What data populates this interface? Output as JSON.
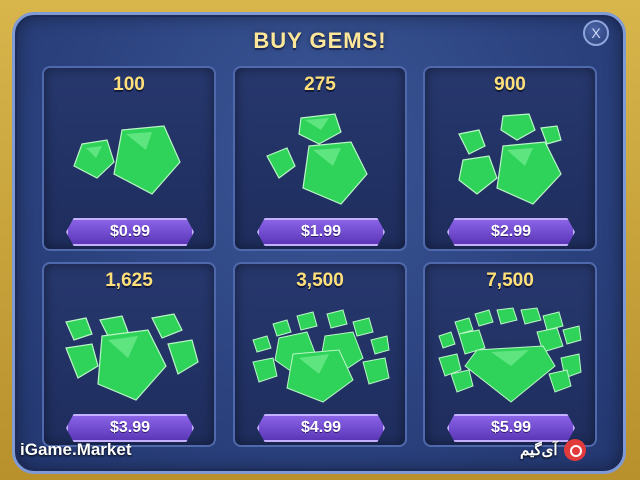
{
  "dialog": {
    "title": "BUY GEMS!",
    "close_label": "X"
  },
  "offers": [
    {
      "amount": "100",
      "price": "$0.99",
      "icon": "gem-pile-small-icon"
    },
    {
      "amount": "275",
      "price": "$1.99",
      "icon": "gem-pile-icon"
    },
    {
      "amount": "900",
      "price": "$2.99",
      "icon": "gem-pile-icon"
    },
    {
      "amount": "1,625",
      "price": "$3.99",
      "icon": "gem-pile-large-icon"
    },
    {
      "amount": "3,500",
      "price": "$4.99",
      "icon": "gem-heap-icon"
    },
    {
      "amount": "7,500",
      "price": "$5.99",
      "icon": "gem-heap-large-icon"
    }
  ],
  "watermark": {
    "left_text": "iGame.Market",
    "right_text": "آی‌گیم"
  },
  "colors": {
    "panel": "#2c4380",
    "gem": "#2fd35a",
    "button": "#6f4bd0",
    "amount_text": "#ffe07a"
  }
}
